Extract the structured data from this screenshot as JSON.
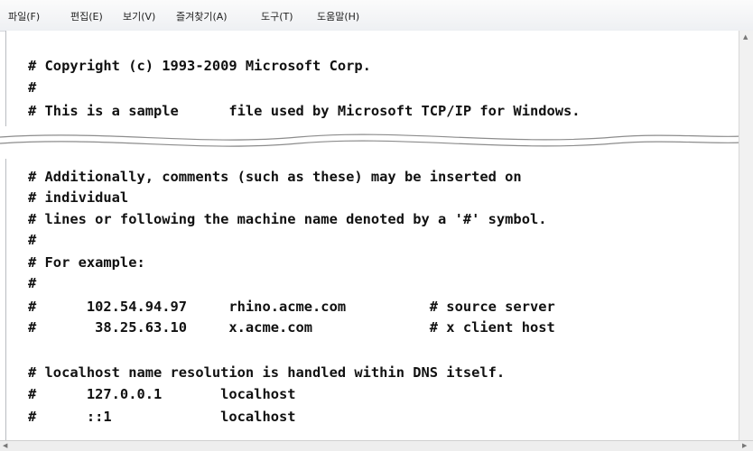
{
  "menu": {
    "file": "파일(F)",
    "edit": "편집(E)",
    "view": "보기(V)",
    "favorites": "즐겨찾기(A)",
    "tools": "도구(T)",
    "help": "도움말(H)"
  },
  "content": {
    "top_lines": [
      "# Copyright (c) 1993-2009 Microsoft Corp.",
      "#",
      "# This is a sample      file used by Microsoft TCP/IP for Windows."
    ],
    "bottom_lines": [
      "# Additionally, comments (such as these) may be inserted on",
      "# individual",
      "# lines or following the machine name denoted by a '#' symbol.",
      "#",
      "# For example:",
      "#",
      "#      102.54.94.97     rhino.acme.com          # source server",
      "#       38.25.63.10     x.acme.com              # x client host",
      "",
      "# localhost name resolution is handled within DNS itself.",
      "#      127.0.0.1       localhost",
      "#      ::1             localhost"
    ]
  }
}
